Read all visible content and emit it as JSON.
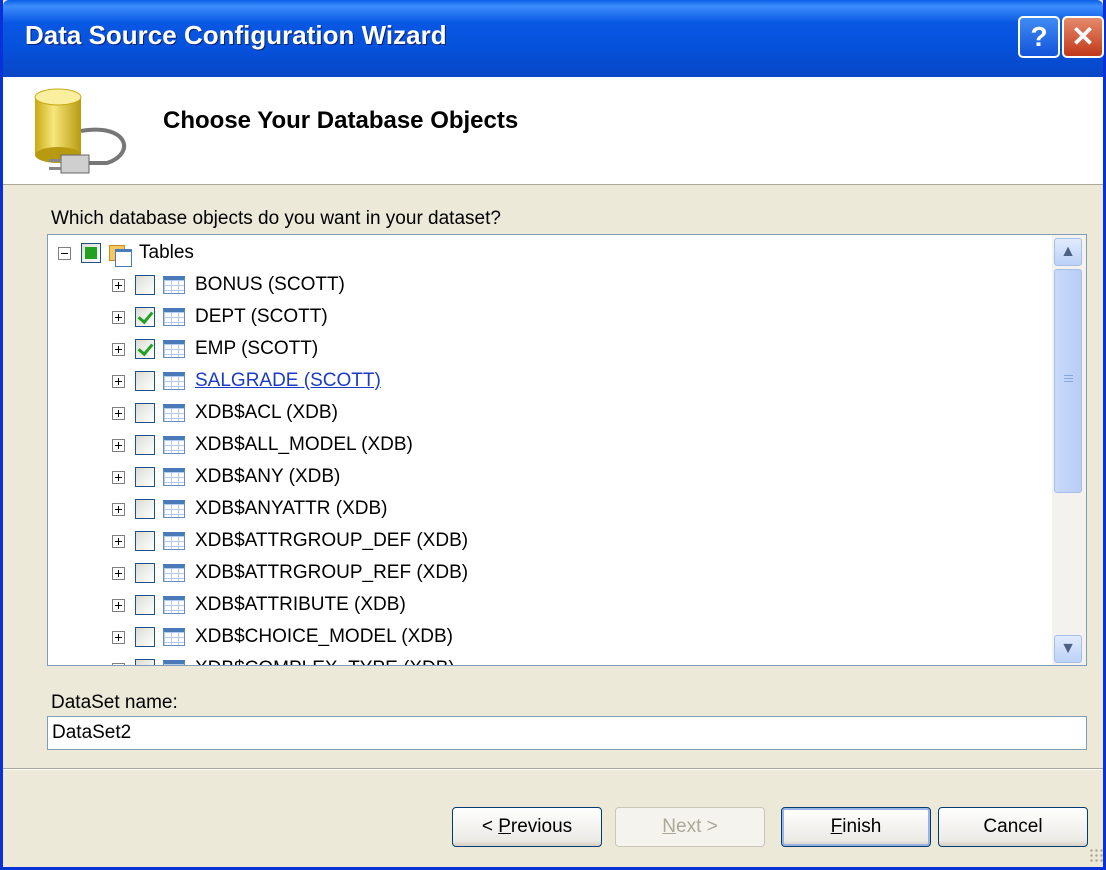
{
  "window": {
    "title": "Data Source Configuration Wizard",
    "help_glyph": "?",
    "close_glyph": "✕"
  },
  "header": {
    "heading": "Choose Your Database Objects",
    "icon": "database-plug-icon"
  },
  "question": "Which database objects do you want in your dataset?",
  "tree": {
    "root": {
      "label": "Tables",
      "expanded": true,
      "check_state": "partial"
    },
    "items": [
      {
        "label": "BONUS (SCOTT)",
        "checked": false
      },
      {
        "label": "DEPT (SCOTT)",
        "checked": true
      },
      {
        "label": "EMP (SCOTT)",
        "checked": true
      },
      {
        "label": "SALGRADE (SCOTT)",
        "checked": false,
        "hover_link": true
      },
      {
        "label": "XDB$ACL (XDB)",
        "checked": false
      },
      {
        "label": "XDB$ALL_MODEL (XDB)",
        "checked": false
      },
      {
        "label": "XDB$ANY (XDB)",
        "checked": false
      },
      {
        "label": "XDB$ANYATTR (XDB)",
        "checked": false
      },
      {
        "label": "XDB$ATTRGROUP_DEF (XDB)",
        "checked": false
      },
      {
        "label": "XDB$ATTRGROUP_REF (XDB)",
        "checked": false
      },
      {
        "label": "XDB$ATTRIBUTE (XDB)",
        "checked": false
      },
      {
        "label": "XDB$CHOICE_MODEL (XDB)",
        "checked": false
      },
      {
        "label": "XDB$COMPLEX_TYPE (XDB)",
        "checked": false
      }
    ]
  },
  "dataset": {
    "label": "DataSet name:",
    "value": "DataSet2"
  },
  "buttons": {
    "previous": "< Previous",
    "next": "Next >",
    "finish": "Finish",
    "cancel": "Cancel"
  }
}
